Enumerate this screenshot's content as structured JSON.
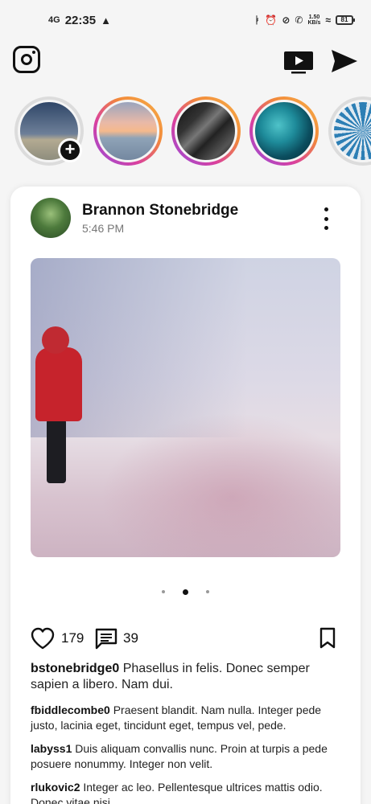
{
  "status_bar": {
    "signal": "4G",
    "time": "22:35",
    "net_speed_value": "1.50",
    "net_speed_unit": "KB/s",
    "battery": "81"
  },
  "stories": [
    {
      "name": "own-story",
      "has_add": true,
      "add_symbol": "+"
    },
    {
      "name": "story-sunset"
    },
    {
      "name": "story-building"
    },
    {
      "name": "story-ocean"
    },
    {
      "name": "story-ferris-wheel"
    }
  ],
  "post": {
    "author": "Brannon Stonebridge",
    "time": "5:46 PM",
    "carousel": {
      "count": 3,
      "active_index": 1
    },
    "likes": "179",
    "comments_count": "39",
    "comments": [
      {
        "user": "bstonebridge0",
        "text": "Phasellus in felis. Donec semper sapien a libero. Nam dui."
      },
      {
        "user": "fbiddlecombe0",
        "text": "Praesent blandit. Nam nulla. Integer pede justo, lacinia eget, tincidunt eget, tempus vel, pede."
      },
      {
        "user": "labyss1",
        "text": "Duis aliquam convallis nunc. Proin at turpis a pede posuere nonummy. Integer non velit."
      },
      {
        "user": "rlukovic2",
        "text": "Integer ac leo. Pellentesque ultrices mattis odio. Donec vitae nisi."
      }
    ]
  },
  "icons": {
    "app_logo": "instagram-icon",
    "igtv": "tv-icon",
    "direct": "send-icon",
    "like": "heart-icon",
    "comment": "comment-icon",
    "save": "bookmark-icon",
    "more": "more-vertical-icon"
  },
  "colors": {
    "story_ring_start": "#8e4fe0",
    "story_ring_end": "#f7b24a",
    "card_background": "#ffffff",
    "page_background": "#f5f5f5"
  }
}
